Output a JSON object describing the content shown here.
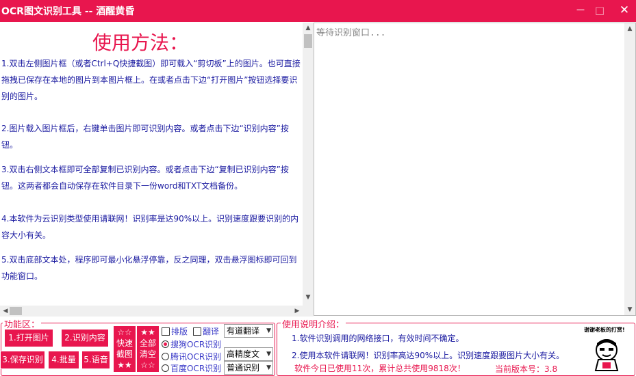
{
  "window": {
    "title": "OCR图文识别工具 -- 酒醒黄昏",
    "minimize_glyph": "－",
    "maximize_glyph": "□",
    "close_glyph": "✕"
  },
  "instructions": {
    "heading": "使用方法：",
    "items": [
      {
        "num": "1.",
        "text": "双击左侧图片框（或者Ctrl+Q快捷截图）即可载入“剪切板”上的图片。也可直接拖拽已保存在本地的图片到本图片框上。在或者点击下边“打开图片”按钮选择要识别的图片。"
      },
      {
        "num": "2.",
        "text": "图片载入图片框后，右键单击图片即可识别内容。或者点击下边“识别内容”按钮。"
      },
      {
        "num": "3.",
        "text": "双击右侧文本框即可全部复制已识别内容。或者点击下边“复制已识别内容”按钮。这两者都会自动保存在软件目录下一份word和TXT文档备份。"
      },
      {
        "num": "4.",
        "text": "本软件为云识别类型使用请联网！识别率是达90%以上。识别速度跟要识别的内容大小有关。"
      },
      {
        "num": "5.",
        "text": "双击底部文本处，程序即可最小化悬浮停靠，反之同理，双击悬浮图标即可回到功能窗口。"
      }
    ]
  },
  "output": {
    "placeholder": "等待识别窗口..."
  },
  "functions": {
    "legend": "功能区：",
    "open_image": "1.打开图片",
    "recognize": "2.识别内容",
    "save": "3.保存识别",
    "batch": "4.批量",
    "voice": "5.语音",
    "quick_shot": [
      "☆☆",
      "快速",
      "截图",
      "★★"
    ],
    "clear_all": [
      "★★",
      "全部",
      "清空",
      "☆☆"
    ],
    "layout_label": "排版",
    "translate_label": "翻译",
    "translate_select": "有道翻译",
    "engines": [
      {
        "label": "搜狗OCR识别",
        "selected": true,
        "select": ""
      },
      {
        "label": "腾讯OCR识别",
        "selected": false,
        "select": "高精度文"
      },
      {
        "label": "百度OCR识别",
        "selected": false,
        "select": "普通识别"
      }
    ]
  },
  "notes": {
    "legend": "使用说明介绍：",
    "line1": "1.软件识别调用的网络接口，有效时间不确定。",
    "line2": "2.使用本软件请联网！识别率高达90%以上。识别速度跟要图片大小有关。",
    "usage": "软件今日已使用11次，累计总共使用9818次！",
    "version": "当前版本号：3.8",
    "thanks": "谢谢老板的打赏!"
  },
  "colors": {
    "accent": "#e8164e",
    "instruction_text": "#1a1aa0"
  }
}
